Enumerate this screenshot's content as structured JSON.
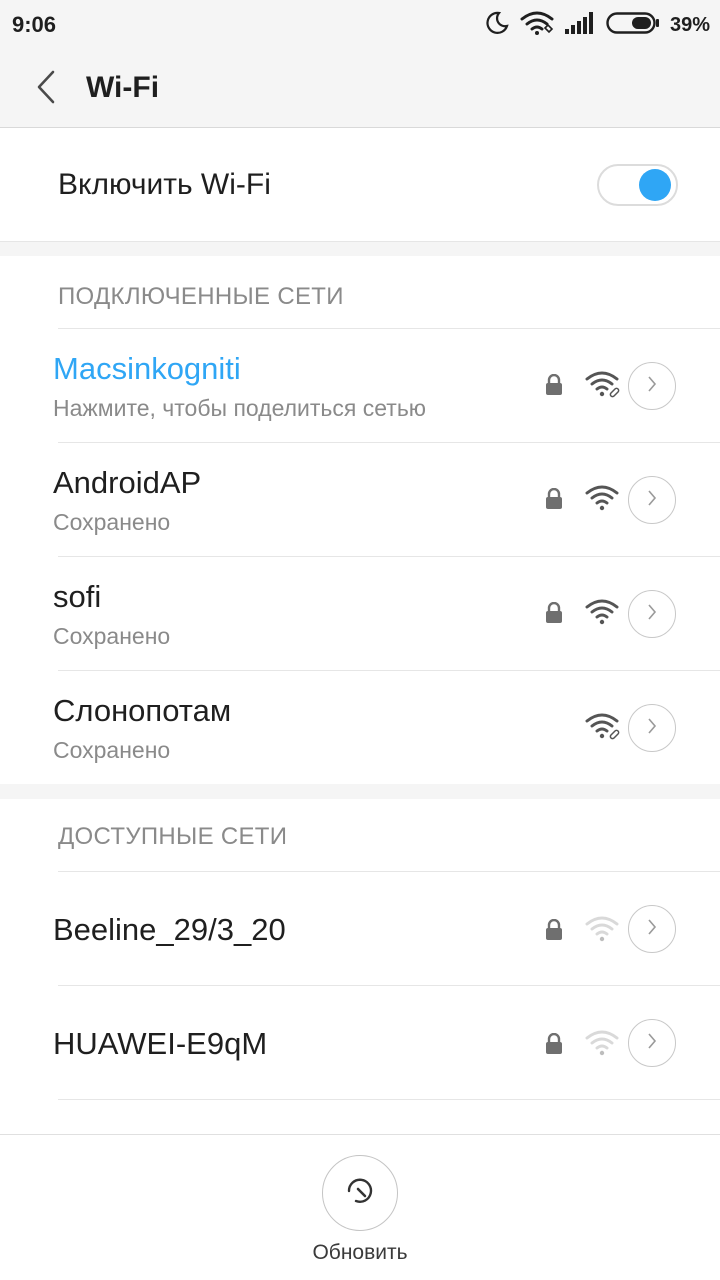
{
  "status_bar": {
    "time": "9:06",
    "battery_percent": "39%",
    "icons": [
      "moon-icon",
      "wifi-status-icon",
      "signal-icon",
      "battery-icon"
    ]
  },
  "app_bar": {
    "title": "Wi-Fi",
    "back_icon": "chevron-left-icon"
  },
  "toggle": {
    "label": "Включить Wi-Fi",
    "on": true,
    "accent": "#2fa6f5"
  },
  "connected": {
    "header": "ПОДКЛЮЧЕННЫЕ СЕТИ",
    "items": [
      {
        "name": "Macsinkogniti",
        "sub": "Нажмите, чтобы поделиться сетью",
        "locked": true,
        "active": true
      },
      {
        "name": "AndroidAP",
        "sub": "Сохранено",
        "locked": true
      },
      {
        "name": "sofi",
        "sub": "Сохранено",
        "locked": true
      },
      {
        "name": "Слонопотам",
        "sub": "Сохранено",
        "locked": false
      }
    ]
  },
  "available": {
    "header": "ДОСТУПНЫЕ СЕТИ",
    "items": [
      {
        "name": "Beeline_29/3_20",
        "locked": true
      },
      {
        "name": "HUAWEI-E9qM",
        "locked": true
      }
    ]
  },
  "bottom": {
    "refresh_label": "Обновить"
  }
}
